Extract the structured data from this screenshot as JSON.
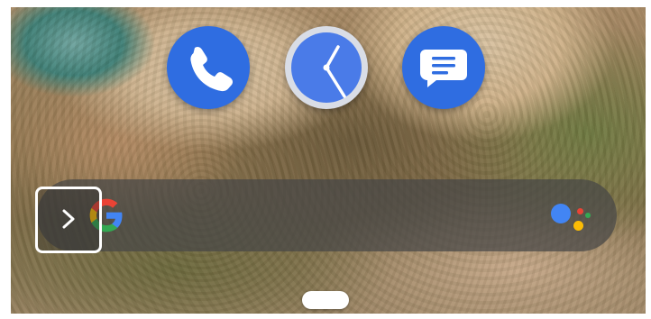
{
  "wallpaper": {
    "description_icon": "aerial-coastline-wallpaper"
  },
  "dock": {
    "apps": [
      {
        "id": "phone",
        "icon": "phone-icon",
        "color": "#2f6de1"
      },
      {
        "id": "clock",
        "icon": "clock-icon",
        "color": "#d9dde6"
      },
      {
        "id": "messages",
        "icon": "messages-icon",
        "color": "#2f6de1"
      }
    ]
  },
  "search_bar": {
    "logo_icon": "google-g-icon",
    "assistant_icon": "google-assistant-icon",
    "expand_icon": "chevron-right-icon",
    "background": "#464646"
  },
  "navigation": {
    "home_handle": "home-gesture-pill"
  }
}
